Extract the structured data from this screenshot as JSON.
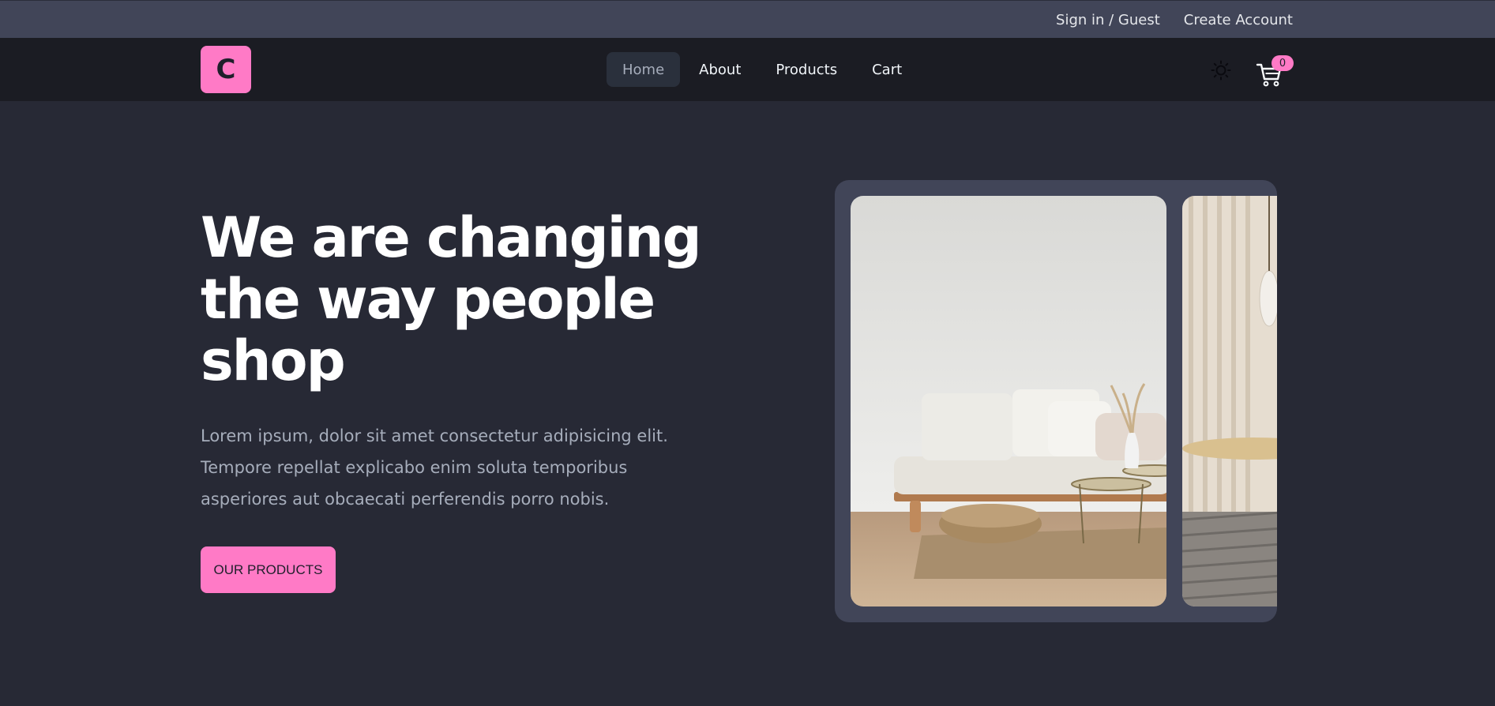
{
  "topbar": {
    "sign_in": "Sign in / Guest",
    "create_account": "Create Account"
  },
  "navbar": {
    "logo_letter": "C",
    "links": [
      {
        "label": "Home",
        "active": true
      },
      {
        "label": "About",
        "active": false
      },
      {
        "label": "Products",
        "active": false
      },
      {
        "label": "Cart",
        "active": false
      }
    ],
    "theme_icon": "sun-icon",
    "cart_icon": "cart-icon",
    "cart_count": "0"
  },
  "hero": {
    "title": "We are changing the way people shop",
    "description": "Lorem ipsum, dolor sit amet consectetur adipisicing elit. Tempore repellat explicabo enim soluta temporibus asperiores aut obcaecati perferendis porro nobis.",
    "button_label": "OUR PRODUCTS"
  },
  "colors": {
    "accent": "#ff7ac6",
    "background": "#272935",
    "topbar": "#414558",
    "navbar": "#1b1c23"
  }
}
